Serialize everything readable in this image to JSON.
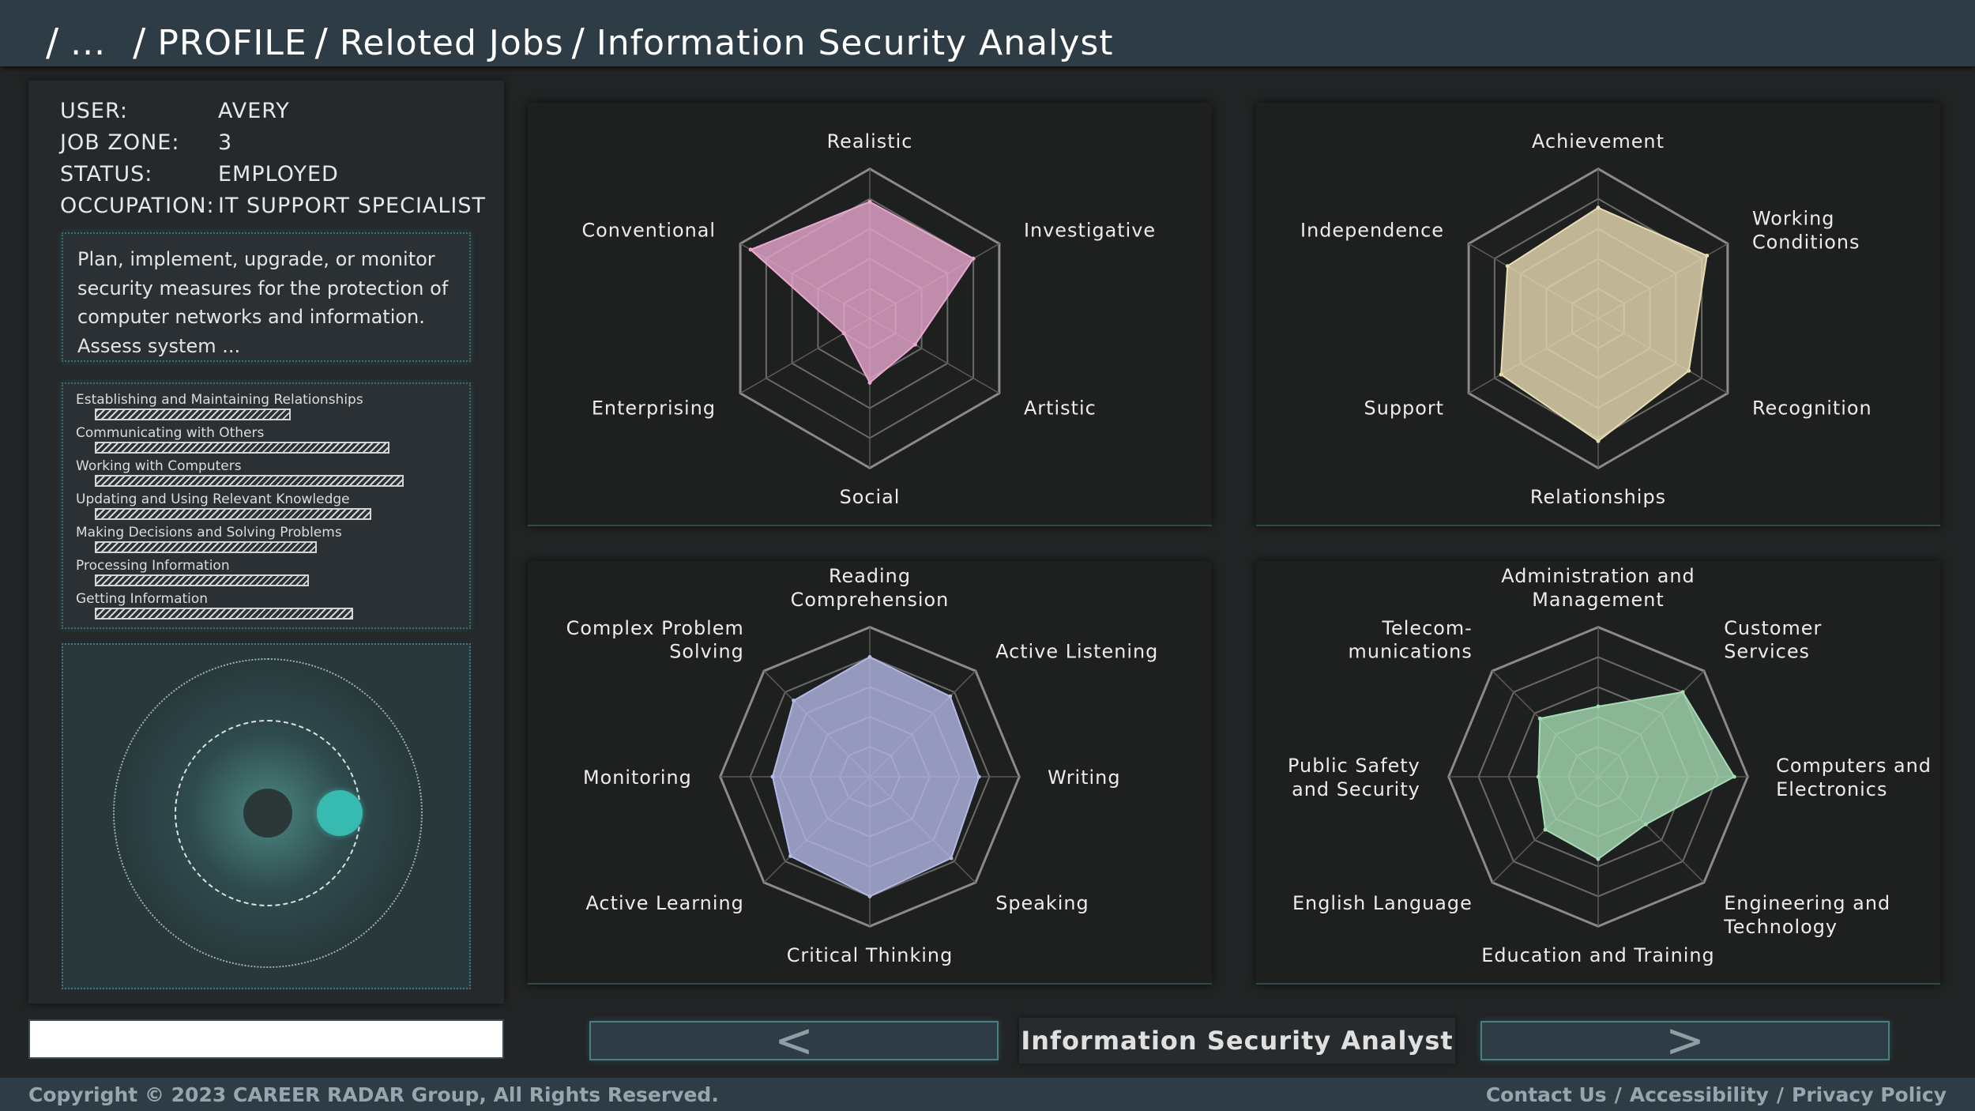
{
  "breadcrumb": {
    "ellipsis": "...",
    "items": [
      "PROFILE",
      "Reloted Jobs",
      "Information Security Analyst"
    ]
  },
  "profile": {
    "rows": [
      {
        "key": "USER:",
        "value": "AVERY"
      },
      {
        "key": "JOB ZONE:",
        "value": "3"
      },
      {
        "key": "STATUS:",
        "value": "EMPLOYED"
      },
      {
        "key": "OCCUPATION:",
        "value": "IT SUPPORT SPECIALIST"
      }
    ],
    "description": "Plan, implement, upgrade, or monitor security measures for the protection of computer networks and information. Assess system ..."
  },
  "skills": [
    {
      "label": "Establishing and Maintaining Relationships",
      "value": 0.54
    },
    {
      "label": "Communicating with Others",
      "value": 0.81
    },
    {
      "label": "Working with Computers",
      "value": 0.85
    },
    {
      "label": "Updating and Using Relevant Knowledge",
      "value": 0.76
    },
    {
      "label": "Making Decisions and Solving Problems",
      "value": 0.61
    },
    {
      "label": "Processing Information",
      "value": 0.59
    },
    {
      "label": "Getting Information",
      "value": 0.71
    }
  ],
  "colors": {
    "interests": "#e8a8cf",
    "work_values": "#e8dcb4",
    "abilities": "#b4b8e6",
    "knowledge": "#a6dcb4",
    "accent": "#37bab0"
  },
  "charts": [
    {
      "id": "interests",
      "labels": [
        [
          "Realistic"
        ],
        [
          "Investigative"
        ],
        [
          "Artistic"
        ],
        [
          "Social"
        ],
        [
          "Enterprising"
        ],
        [
          "Conventional"
        ]
      ],
      "values": [
        0.78,
        0.8,
        0.35,
        0.43,
        0.2,
        0.92
      ]
    },
    {
      "id": "work-values",
      "labels": [
        [
          "Achievement"
        ],
        [
          "Working",
          "Conditions"
        ],
        [
          "Recognition"
        ],
        [
          "Relationships"
        ],
        [
          "Support"
        ],
        [
          "Independence"
        ]
      ],
      "values": [
        0.74,
        0.84,
        0.7,
        0.82,
        0.75,
        0.7
      ]
    },
    {
      "id": "abilities",
      "labels": [
        [
          "Reading",
          "Comprehension"
        ],
        [
          "Active Listening"
        ],
        [
          "Writing"
        ],
        [
          "Speaking"
        ],
        [
          "Critical Thinking"
        ],
        [
          "Active Learning"
        ],
        [
          "Monitoring"
        ],
        [
          "Complex Problem",
          "Solving"
        ]
      ],
      "values": [
        0.8,
        0.76,
        0.73,
        0.77,
        0.8,
        0.75,
        0.65,
        0.72
      ]
    },
    {
      "id": "knowledge",
      "labels": [
        [
          "Administration and",
          "Management"
        ],
        [
          "Customer",
          "Services"
        ],
        [
          "Computers and",
          "Electronics"
        ],
        [
          "Engineering and",
          "Technology"
        ],
        [
          "Education and Training"
        ],
        [
          "English Language"
        ],
        [
          "Public Safety",
          "and Security"
        ],
        [
          "Telecom-",
          "munications"
        ]
      ],
      "values": [
        0.47,
        0.8,
        0.91,
        0.45,
        0.55,
        0.5,
        0.4,
        0.55
      ]
    }
  ],
  "nav": {
    "prev": "<",
    "next": ">",
    "title": "Information Security Analyst"
  },
  "footer": {
    "copyright": "Copyright © 2023 CAREER RADAR Group, All Rights Reserved.",
    "links": [
      "Contact Us",
      "Accessibility",
      "Privacy Policy"
    ],
    "separator": "/"
  }
}
